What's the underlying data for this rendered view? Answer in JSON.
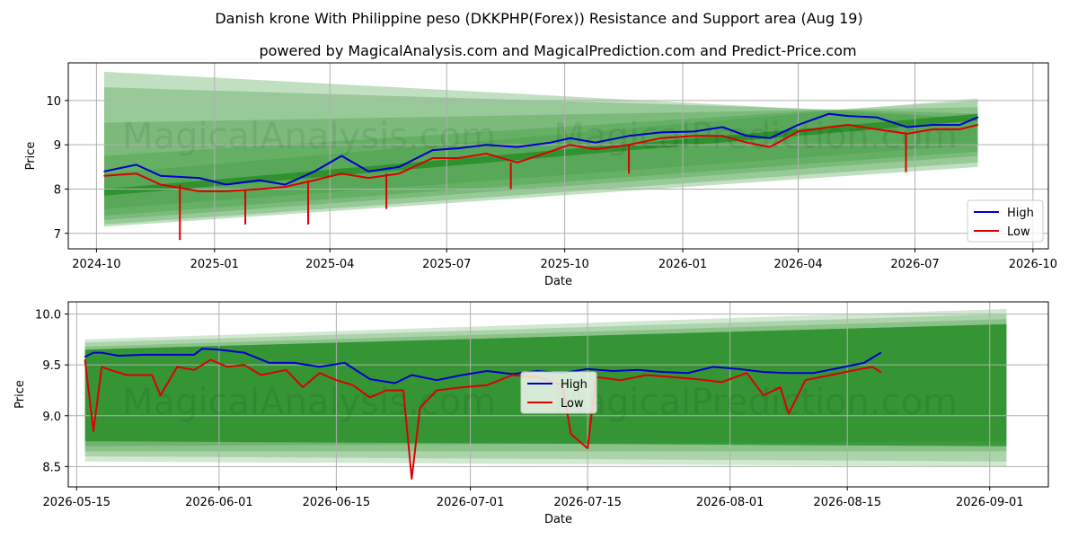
{
  "title": "Danish krone With Philippine peso (DKKPHP(Forex)) Resistance and Support area (Aug 19)",
  "subtitle": "powered by MagicalAnalysis.com and MagicalPrediction.com and Predict-Price.com",
  "watermarks": [
    "MagicalAnalysis.com",
    "MagicalPrediction.com"
  ],
  "colors": {
    "high": "#0000cc",
    "low": "#dd0000",
    "band": "#228b22",
    "grid": "#b0b0b0"
  },
  "chart_data": [
    {
      "type": "line",
      "xlabel": "Date",
      "ylabel": "Price",
      "x_ticks": [
        "2024-10",
        "2025-01",
        "2025-04",
        "2025-07",
        "2025-10",
        "2026-01",
        "2026-04",
        "2026-07",
        "2026-10"
      ],
      "y_ticks": [
        "7",
        "8",
        "9",
        "10"
      ],
      "ylim": [
        6.65,
        10.85
      ],
      "xlim": [
        "2024-09-09",
        "2026-10-13"
      ],
      "grid": true,
      "legend": "bottom-right",
      "series": [
        {
          "name": "High",
          "x": [
            "2024-10-07",
            "2024-11-01",
            "2024-11-20",
            "2024-12-20",
            "2025-01-10",
            "2025-02-05",
            "2025-02-25",
            "2025-03-20",
            "2025-04-10",
            "2025-05-01",
            "2025-05-25",
            "2025-06-20",
            "2025-07-10",
            "2025-08-01",
            "2025-08-25",
            "2025-09-20",
            "2025-10-05",
            "2025-10-25",
            "2025-11-20",
            "2025-12-15",
            "2026-01-10",
            "2026-02-01",
            "2026-02-20",
            "2026-03-10",
            "2026-04-01",
            "2026-04-25",
            "2026-05-10",
            "2026-06-01",
            "2026-06-25",
            "2026-07-15",
            "2026-08-05",
            "2026-08-19"
          ],
          "values": [
            8.4,
            8.55,
            8.3,
            8.25,
            8.1,
            8.2,
            8.1,
            8.4,
            8.75,
            8.4,
            8.5,
            8.88,
            8.92,
            9.0,
            8.95,
            9.05,
            9.15,
            9.05,
            9.2,
            9.28,
            9.3,
            9.4,
            9.2,
            9.15,
            9.45,
            9.7,
            9.65,
            9.62,
            9.4,
            9.45,
            9.45,
            9.62
          ]
        },
        {
          "name": "Low",
          "x": [
            "2024-10-07",
            "2024-11-01",
            "2024-11-20",
            "2024-12-20",
            "2025-01-10",
            "2025-02-05",
            "2025-02-25",
            "2025-03-20",
            "2025-04-10",
            "2025-05-01",
            "2025-05-25",
            "2025-06-20",
            "2025-07-10",
            "2025-08-01",
            "2025-08-25",
            "2025-09-20",
            "2025-10-05",
            "2025-10-25",
            "2025-11-20",
            "2025-12-15",
            "2026-01-10",
            "2026-02-01",
            "2026-02-20",
            "2026-03-10",
            "2026-04-01",
            "2026-04-25",
            "2026-05-10",
            "2026-06-01",
            "2026-06-25",
            "2026-07-15",
            "2026-08-05",
            "2026-08-19"
          ],
          "values": [
            8.3,
            8.35,
            8.1,
            7.95,
            7.95,
            8.0,
            8.05,
            8.2,
            8.35,
            8.25,
            8.35,
            8.7,
            8.7,
            8.8,
            8.6,
            8.85,
            9.0,
            8.9,
            9.0,
            9.15,
            9.2,
            9.2,
            9.05,
            8.95,
            9.3,
            9.4,
            9.45,
            9.35,
            9.25,
            9.35,
            9.35,
            9.45
          ]
        }
      ],
      "spikes_low": [
        [
          "2024-12-05",
          6.85
        ],
        [
          "2025-01-25",
          7.2
        ],
        [
          "2025-03-15",
          7.2
        ],
        [
          "2025-05-15",
          7.55
        ],
        [
          "2025-08-20",
          8.0
        ],
        [
          "2025-11-20",
          8.35
        ],
        [
          "2026-06-24",
          8.38
        ]
      ],
      "band_start": "2024-10-07",
      "band_end": "2026-08-19",
      "bands": [
        {
          "start": [
            7.55,
            8.35
          ],
          "end": [
            9.0,
            10.05
          ]
        },
        {
          "start": [
            7.4,
            8.75
          ],
          "end": [
            8.85,
            10.0
          ]
        },
        {
          "start": [
            7.3,
            9.5
          ],
          "end": [
            8.75,
            9.85
          ]
        },
        {
          "start": [
            7.2,
            10.3
          ],
          "end": [
            8.6,
            9.7
          ]
        },
        {
          "start": [
            7.15,
            10.65
          ],
          "end": [
            8.5,
            9.6
          ]
        }
      ]
    },
    {
      "type": "line",
      "xlabel": "Date",
      "ylabel": "Price",
      "x_ticks": [
        "2026-05-15",
        "2026-06-01",
        "2026-06-15",
        "2026-07-01",
        "2026-07-15",
        "2026-08-01",
        "2026-08-15",
        "2026-09-01"
      ],
      "y_ticks": [
        "8.5",
        "9.0",
        "9.5",
        "10.0"
      ],
      "ylim": [
        8.3,
        10.12
      ],
      "xlim": [
        "2026-05-14",
        "2026-09-08"
      ],
      "grid": true,
      "legend": "center",
      "series": [
        {
          "name": "High",
          "x": [
            "2026-05-16",
            "2026-05-17",
            "2026-05-18",
            "2026-05-20",
            "2026-05-23",
            "2026-05-26",
            "2026-05-29",
            "2026-05-30",
            "2026-06-01",
            "2026-06-04",
            "2026-06-07",
            "2026-06-10",
            "2026-06-13",
            "2026-06-16",
            "2026-06-19",
            "2026-06-22",
            "2026-06-24",
            "2026-06-27",
            "2026-06-30",
            "2026-07-03",
            "2026-07-06",
            "2026-07-09",
            "2026-07-12",
            "2026-07-15",
            "2026-07-18",
            "2026-07-21",
            "2026-07-24",
            "2026-07-27",
            "2026-07-30",
            "2026-08-02",
            "2026-08-05",
            "2026-08-08",
            "2026-08-11",
            "2026-08-14",
            "2026-08-17",
            "2026-08-19"
          ],
          "values": [
            9.58,
            9.62,
            9.62,
            9.59,
            9.6,
            9.6,
            9.6,
            9.66,
            9.65,
            9.62,
            9.52,
            9.52,
            9.48,
            9.52,
            9.36,
            9.32,
            9.4,
            9.35,
            9.4,
            9.44,
            9.41,
            9.44,
            9.42,
            9.46,
            9.44,
            9.45,
            9.43,
            9.42,
            9.48,
            9.46,
            9.43,
            9.42,
            9.42,
            9.47,
            9.52,
            9.62
          ]
        },
        {
          "name": "Low",
          "x": [
            "2026-05-16",
            "2026-05-17",
            "2026-05-18",
            "2026-05-19",
            "2026-05-21",
            "2026-05-23",
            "2026-05-24",
            "2026-05-25",
            "2026-05-27",
            "2026-05-29",
            "2026-05-31",
            "2026-06-02",
            "2026-06-04",
            "2026-06-06",
            "2026-06-09",
            "2026-06-11",
            "2026-06-13",
            "2026-06-15",
            "2026-06-17",
            "2026-06-19",
            "2026-06-21",
            "2026-06-23",
            "2026-06-24",
            "2026-06-25",
            "2026-06-27",
            "2026-06-30",
            "2026-07-03",
            "2026-07-06",
            "2026-07-09",
            "2026-07-12",
            "2026-07-13",
            "2026-07-15",
            "2026-07-16",
            "2026-07-19",
            "2026-07-22",
            "2026-07-25",
            "2026-07-28",
            "2026-07-31",
            "2026-08-03",
            "2026-08-05",
            "2026-08-07",
            "2026-08-08",
            "2026-08-10",
            "2026-08-13",
            "2026-08-16",
            "2026-08-18",
            "2026-08-19"
          ],
          "values": [
            9.55,
            8.85,
            9.48,
            9.45,
            9.4,
            9.4,
            9.4,
            9.2,
            9.48,
            9.45,
            9.55,
            9.48,
            9.5,
            9.4,
            9.45,
            9.28,
            9.42,
            9.35,
            9.3,
            9.18,
            9.25,
            9.25,
            8.38,
            9.08,
            9.25,
            9.28,
            9.3,
            9.4,
            9.38,
            9.3,
            8.82,
            8.68,
            9.38,
            9.35,
            9.4,
            9.38,
            9.36,
            9.33,
            9.42,
            9.2,
            9.28,
            9.02,
            9.35,
            9.4,
            9.45,
            9.48,
            9.43
          ]
        }
      ],
      "band_start": "2026-05-16",
      "band_end": "2026-09-03",
      "bands": [
        {
          "start": [
            8.55,
            9.75
          ],
          "end": [
            8.5,
            10.05
          ]
        },
        {
          "start": [
            8.6,
            9.72
          ],
          "end": [
            8.55,
            10.0
          ]
        },
        {
          "start": [
            8.65,
            9.68
          ],
          "end": [
            8.65,
            9.95
          ]
        },
        {
          "start": [
            8.7,
            9.65
          ],
          "end": [
            8.75,
            9.9
          ]
        }
      ]
    }
  ]
}
